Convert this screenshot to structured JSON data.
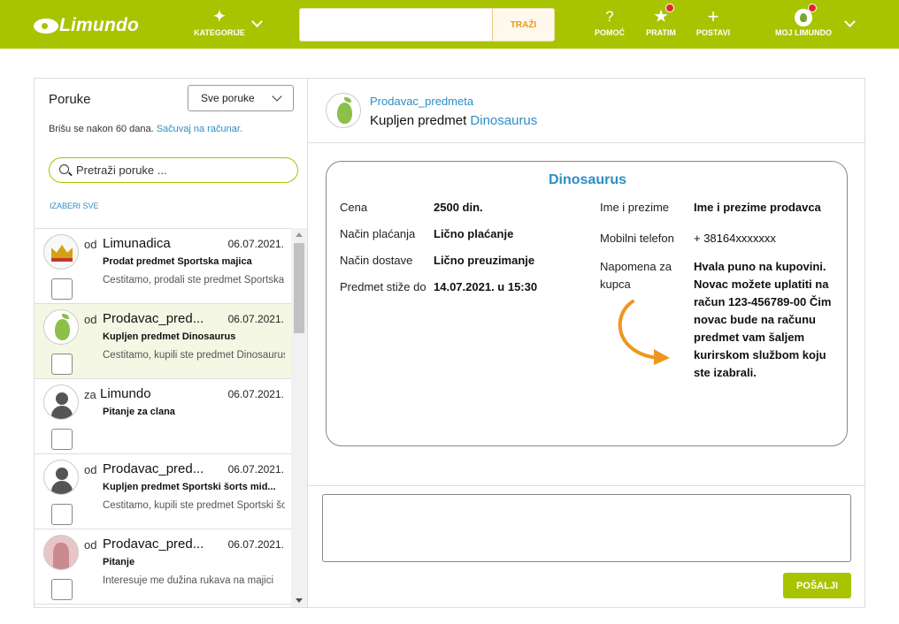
{
  "brand": {
    "logo_text": "Limundo",
    "accent": "#a8c400",
    "link": "#2b8ec6",
    "orange": "#f0961e"
  },
  "nav": {
    "categories": "KATEGORIJE",
    "search_button": "TRAŽI",
    "search_value": "",
    "help": "POMOĆ",
    "watch": "PRATIM",
    "post": "POSTAVI",
    "my_account": "MOJ LIMUNDO",
    "icons": {
      "categories": "sparkle-icon",
      "help": "question-icon",
      "watch": "star-icon",
      "post": "plus-icon",
      "my_account": "profile-icon"
    }
  },
  "inbox": {
    "title": "Poruke",
    "filter": "Sve poruke",
    "note": "Brišu se nakon 60 dana.",
    "save_link": "Sačuvaj na računar.",
    "search_placeholder": "Pretraži poruke ...",
    "select_all": "IZABERI SVE",
    "messages": [
      {
        "dir": "od",
        "who": "Limunadica",
        "date": "06.07.2021.",
        "subject": "Prodat predmet Sportska majica",
        "preview": "Čestitamo, prodali ste predmet Sportska majica",
        "avatar": "crown",
        "selected": false
      },
      {
        "dir": "od",
        "who": "Prodavac_pred...",
        "date": "06.07.2021.",
        "subject": "Kupljen predmet Dinosaurus",
        "preview": "Čestitamo, kupili ste predmet Dinosaurus",
        "avatar": "limundo",
        "selected": true
      },
      {
        "dir": "za",
        "who": "Limundo",
        "date": "06.07.2021.",
        "subject": "Pitanje za clana",
        "preview": "",
        "avatar": "default",
        "selected": false
      },
      {
        "dir": "od",
        "who": "Prodavac_pred...",
        "date": "06.07.2021.",
        "subject": "Kupljen predmet Sportski šorts mid...",
        "preview": "Čestitamo, kupili ste predmet Sportski šorts",
        "avatar": "default",
        "selected": false
      },
      {
        "dir": "od",
        "who": "Prodavac_pred...",
        "date": "06.07.2021.",
        "subject": "Pitanje",
        "preview": "Interesuje me dužina rukava na majici",
        "avatar": "photo",
        "selected": false
      }
    ]
  },
  "conversation": {
    "sender": "Prodavac_predmeta",
    "subject_prefix": "Kupljen predmet",
    "subject_item": "Dinosaurus",
    "card": {
      "title": "Dinosaurus",
      "price_label": "Cena",
      "price": "2500 din.",
      "payment_label": "Način plaćanja",
      "payment": "Lično plaćanje",
      "delivery_label": "Način dostave",
      "delivery": "Lično preuzimanje",
      "arrives_label": "Predmet stiže do",
      "arrives": "14.07.2021. u 15:30",
      "name_label": "Ime i prezime",
      "name": "Ime i prezime prodavca",
      "phone_label": "Mobilni telefon",
      "phone": "+ 38164xxxxxxx",
      "note_label": "Napomena za kupca",
      "note": "Hvala puno na kupovini. Novac možete uplatiti na račun 123-456789-00 Čim novac bude na računu predmet vam šaljem kurirskom službom koju ste izabrali."
    },
    "reply_value": "",
    "send_label": "POŠALJI"
  }
}
